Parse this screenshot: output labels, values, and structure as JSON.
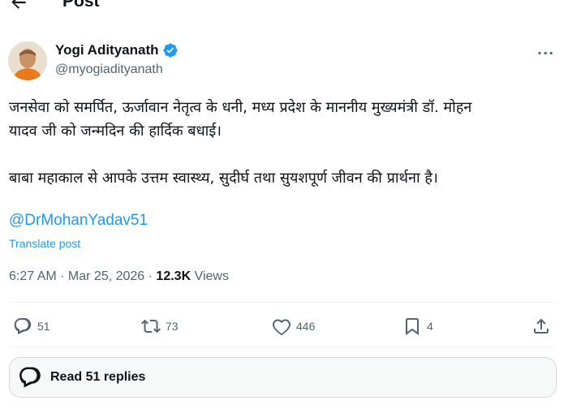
{
  "header": {
    "title": "Post",
    "back_icon": "arrow-left-icon"
  },
  "author": {
    "name": "Yogi Adityanath",
    "handle": "@myogiadityanath",
    "verified_icon": "verified-badge-icon",
    "verified_color": "#1d9bf0"
  },
  "more_label": "···",
  "post": {
    "line1": "जनसेवा को समर्पित, ऊर्जावान नेतृत्व के धनी, मध्य प्रदेश के माननीय मुख्यमंत्री डॉ. मोहन",
    "line2": "यादव जी को जन्मदिन की हार्दिक बधाई।",
    "line3": "बाबा महाकाल से आपके उत्तम स्वास्थ्य, सुदीर्घ तथा सुयशपूर्ण जीवन की प्रार्थना है।",
    "mention": "@DrMohanYadav51",
    "translate_label": "Translate post"
  },
  "meta": {
    "time_date": "6:27 AM · Mar 25, 2026 · ",
    "views_count": "12.3K",
    "views_label": " Views"
  },
  "actions": {
    "replies": "51",
    "reposts": "73",
    "likes": "446",
    "bookmarks": "4"
  },
  "read_replies_label": "Read 51 replies",
  "colors": {
    "accent": "#1d9bf0",
    "text": "#0f1419",
    "secondary": "#536471"
  }
}
